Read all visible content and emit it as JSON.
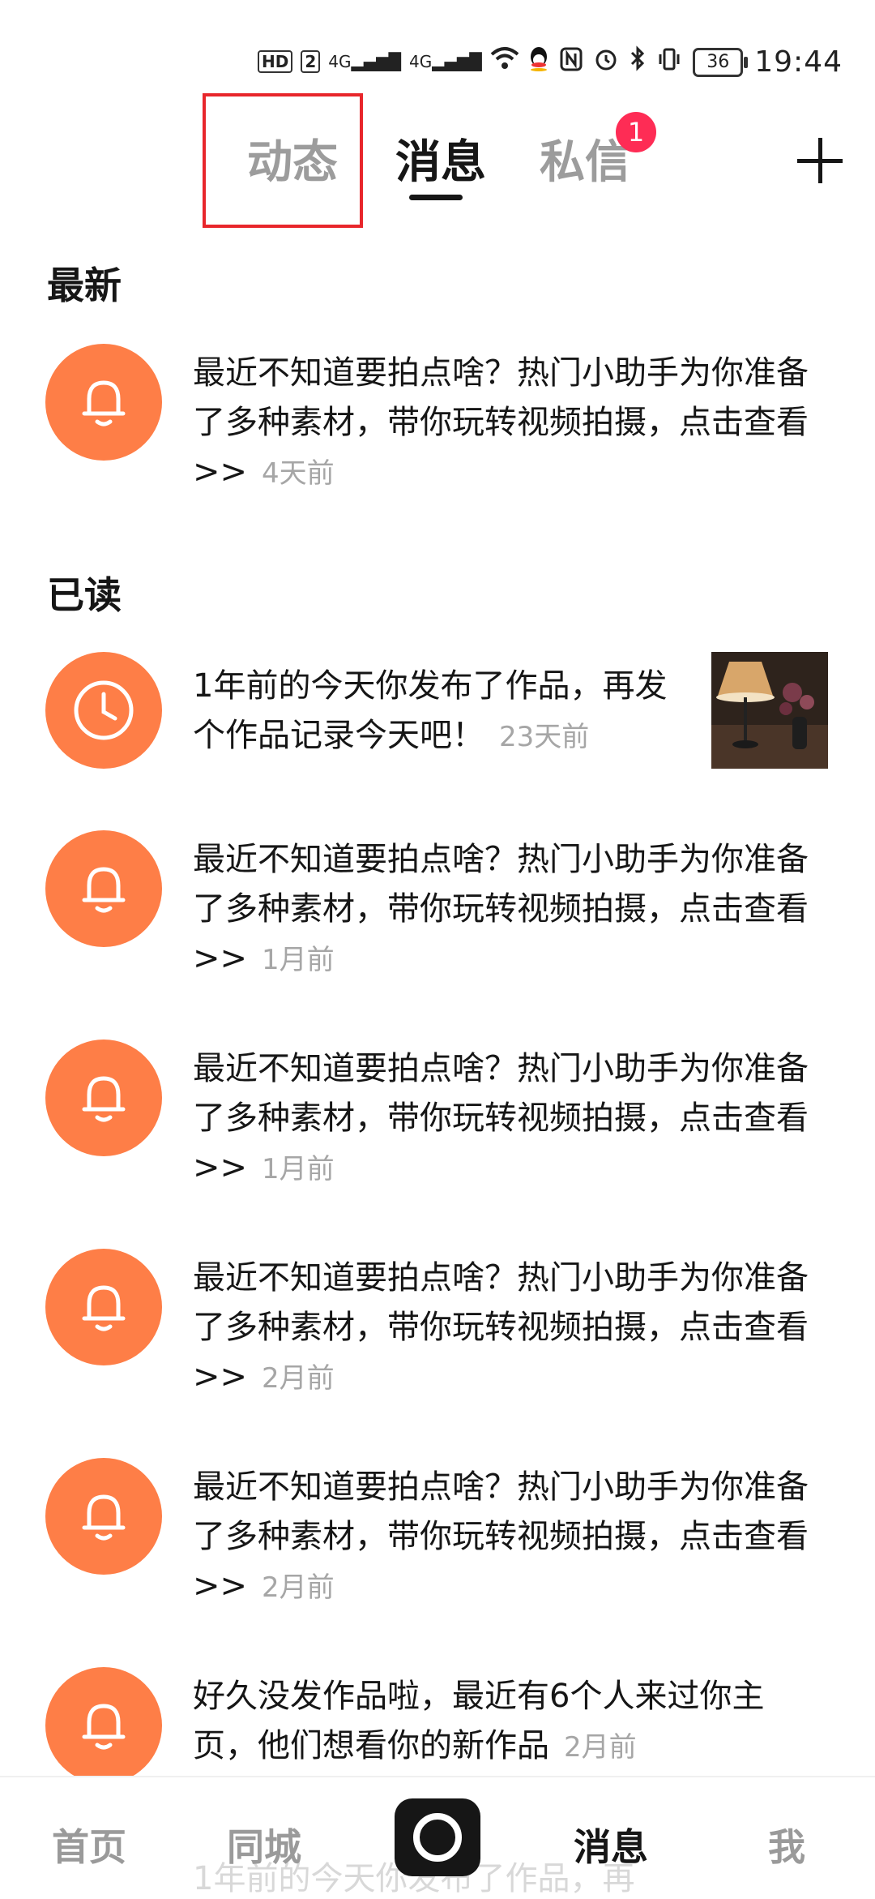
{
  "status_bar": {
    "hd": "HD",
    "sim": "2",
    "signal1": "4G",
    "signal2": "4G",
    "battery": "36",
    "time": "19:44"
  },
  "tabs": {
    "dynamic": "动态",
    "messages": "消息",
    "dm": "私信",
    "dm_badge": "1"
  },
  "sections": {
    "latest": "最新",
    "read": "已读"
  },
  "items": [
    {
      "text": "最近不知道要拍点啥？热门小助手为你准备了多种素材，带你玩转视频拍摄，点击查看>>",
      "time": "4天前",
      "icon": "bell-icon"
    },
    {
      "text": "1年前的今天你发布了作品，再发个作品记录今天吧！",
      "time": "23天前",
      "icon": "clock-icon"
    },
    {
      "text": "最近不知道要拍点啥？热门小助手为你准备了多种素材，带你玩转视频拍摄，点击查看>>",
      "time": "1月前",
      "icon": "bell-icon"
    },
    {
      "text": "最近不知道要拍点啥？热门小助手为你准备了多种素材，带你玩转视频拍摄，点击查看>>",
      "time": "1月前",
      "icon": "bell-icon"
    },
    {
      "text": "最近不知道要拍点啥？热门小助手为你准备了多种素材，带你玩转视频拍摄，点击查看>>",
      "time": "2月前",
      "icon": "bell-icon"
    },
    {
      "text": "最近不知道要拍点啥？热门小助手为你准备了多种素材，带你玩转视频拍摄，点击查看>>",
      "time": "2月前",
      "icon": "bell-icon"
    },
    {
      "text": "好久没发作品啦，最近有6个人来过你主页，他们想看你的新作品",
      "time": "2月前",
      "icon": "bell-icon"
    }
  ],
  "peek_text": "1年前的今天你发布了作品，再",
  "bottom_nav": {
    "home": "首页",
    "city": "同城",
    "messages": "消息",
    "me": "我"
  },
  "colors": {
    "accent": "#fe7e47",
    "badge": "#fe2c55",
    "highlight": "#e8262b"
  }
}
